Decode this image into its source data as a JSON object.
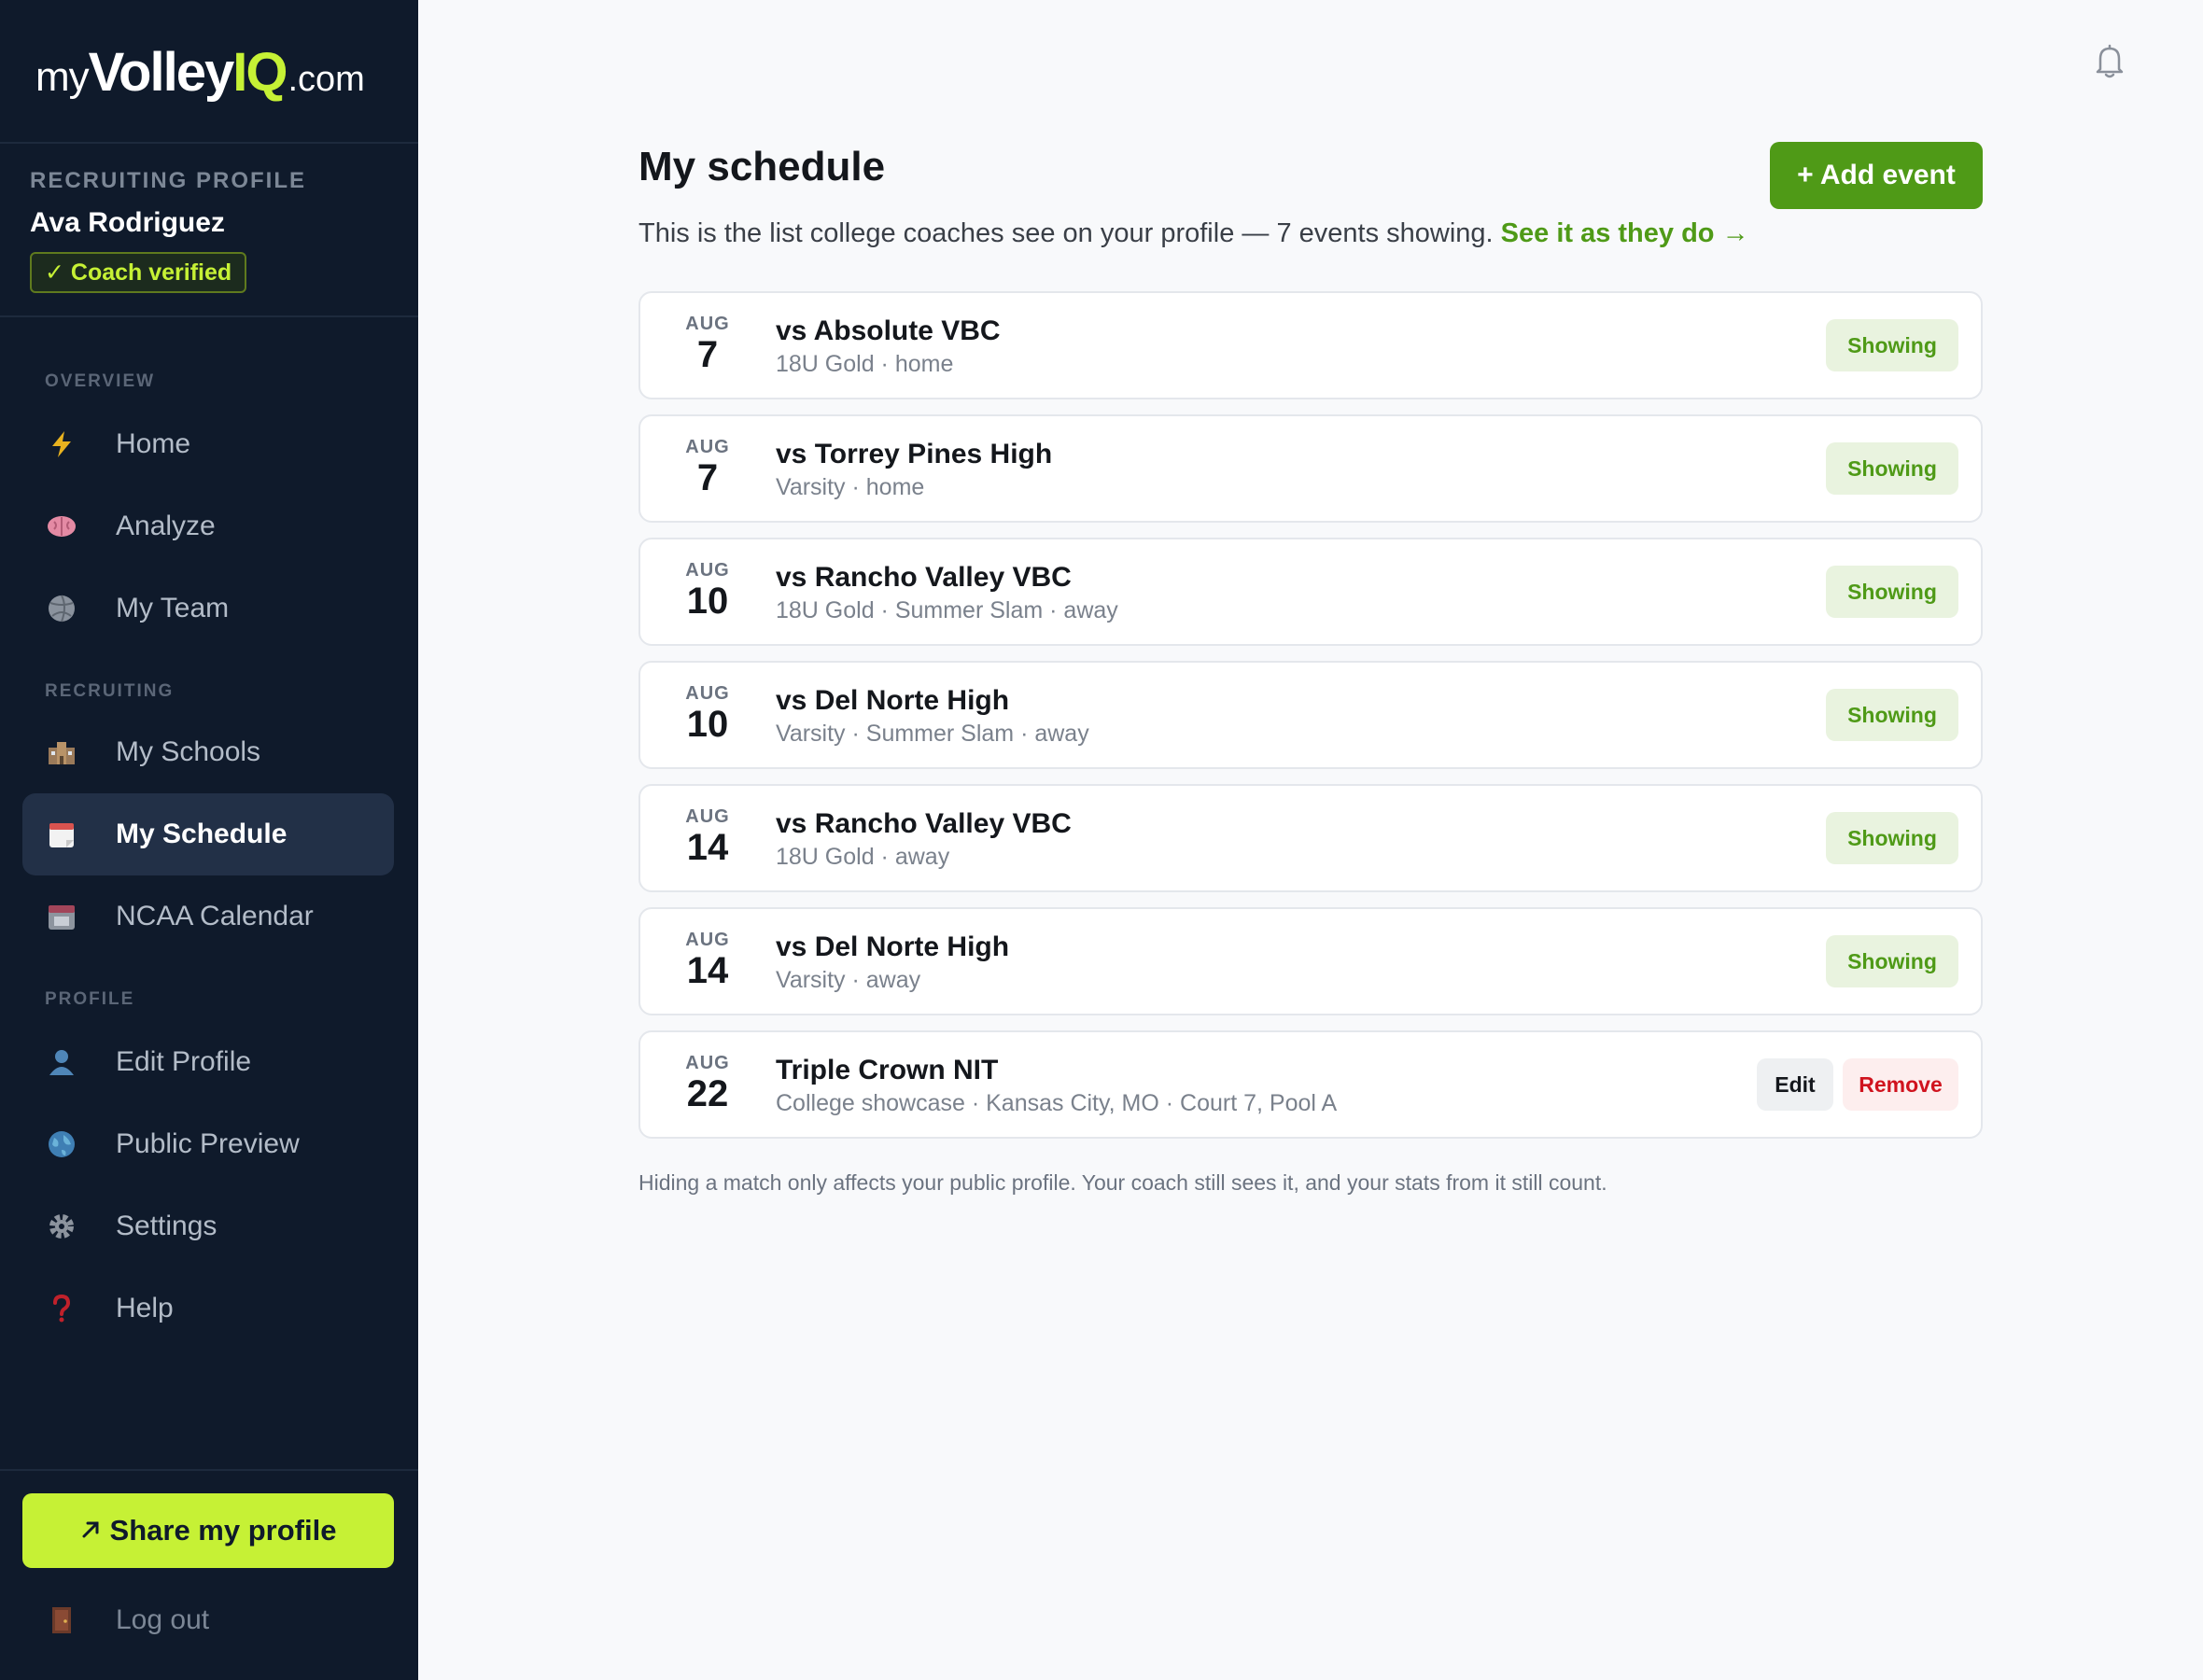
{
  "brand": {
    "my": "my",
    "volley": "Volley",
    "iq": "IQ",
    "dotcom": ".com"
  },
  "sidebar": {
    "profile_label": "RECRUITING PROFILE",
    "profile_name": "Ava Rodriguez",
    "verified_label": "✓ Coach verified",
    "sections": {
      "overview": "OVERVIEW",
      "recruiting": "RECRUITING",
      "profile": "PROFILE"
    },
    "items": {
      "home": "Home",
      "analyze": "Analyze",
      "my_team": "My Team",
      "my_schools": "My Schools",
      "my_schedule": "My Schedule",
      "ncaa_calendar": "NCAA Calendar",
      "edit_profile": "Edit Profile",
      "public_preview": "Public Preview",
      "settings": "Settings",
      "help": "Help"
    },
    "share_label": "Share my profile",
    "logout_label": "Log out"
  },
  "main": {
    "title": "My schedule",
    "add_event_label": "+ Add event",
    "subtitle": "This is the list college coaches see on your profile — 7 events showing.",
    "subtitle_link": "See it as they do →",
    "events": [
      {
        "month": "AUG",
        "day": "7",
        "title": "vs Absolute VBC",
        "sub": "18U Gold · home",
        "status": "Showing"
      },
      {
        "month": "AUG",
        "day": "7",
        "title": "vs Torrey Pines High",
        "sub": "Varsity · home",
        "status": "Showing"
      },
      {
        "month": "AUG",
        "day": "10",
        "title": "vs Rancho Valley VBC",
        "sub": "18U Gold · Summer Slam · away",
        "status": "Showing"
      },
      {
        "month": "AUG",
        "day": "10",
        "title": "vs Del Norte High",
        "sub": "Varsity · Summer Slam · away",
        "status": "Showing"
      },
      {
        "month": "AUG",
        "day": "14",
        "title": "vs Rancho Valley VBC",
        "sub": "18U Gold · away",
        "status": "Showing"
      },
      {
        "month": "AUG",
        "day": "14",
        "title": "vs Del Norte High",
        "sub": "Varsity · away",
        "status": "Showing"
      },
      {
        "month": "AUG",
        "day": "22",
        "title": "Triple Crown NIT",
        "sub": "College showcase · Kansas City, MO · Court 7, Pool A",
        "edit_label": "Edit",
        "remove_label": "Remove"
      }
    ],
    "footnote": "Hiding a match only affects your public profile. Your coach still sees it, and your stats from it still count."
  },
  "colors": {
    "sidebar_bg": "#0f1a2b",
    "accent_lime": "#c6f135",
    "accent_green": "#4f9a17",
    "danger": "#d0131e"
  }
}
